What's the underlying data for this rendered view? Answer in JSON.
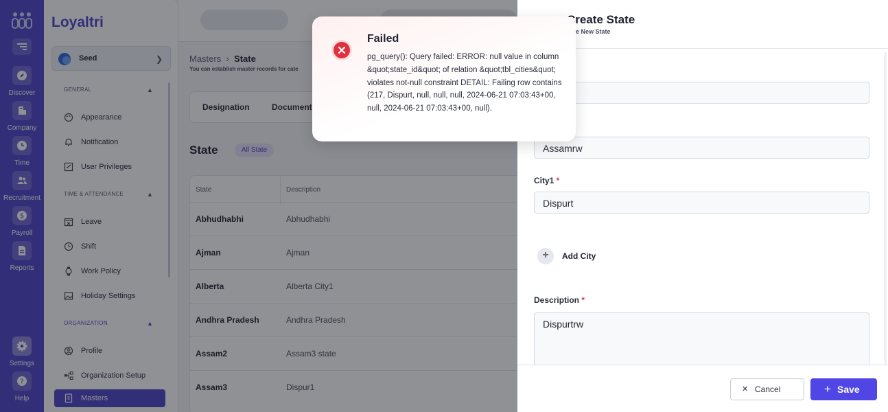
{
  "rail": {
    "items": [
      {
        "label": "Discover",
        "icon": "compass-icon"
      },
      {
        "label": "Company",
        "icon": "building-icon"
      },
      {
        "label": "Time",
        "icon": "clock-icon"
      },
      {
        "label": "Recruitment",
        "icon": "people-icon"
      },
      {
        "label": "Payroll",
        "icon": "dollar-icon"
      },
      {
        "label": "Reports",
        "icon": "report-icon"
      },
      {
        "label": "Settings",
        "icon": "gear-icon"
      },
      {
        "label": "Help",
        "icon": "help-icon"
      }
    ]
  },
  "sidebar": {
    "brand": "Loyaltri",
    "org_name": "Seed",
    "sections": [
      {
        "title": "GENERAL",
        "items": [
          "Appearance",
          "Notification",
          "User Privileges"
        ]
      },
      {
        "title": "TIME & ATTENDANCE",
        "items": [
          "Leave",
          "Shift",
          "Work Policy",
          "Holiday Settings"
        ]
      },
      {
        "title": "ORGANIZATION",
        "items": [
          "Profile",
          "Organization Setup",
          "Masters"
        ]
      }
    ],
    "active_item": "Masters"
  },
  "page": {
    "breadcrumb_parent": "Masters",
    "breadcrumb_current": "State",
    "description": "You can establish master records for cate",
    "tabs": [
      "Designation",
      "Document"
    ],
    "title": "State",
    "badge": "All State"
  },
  "table": {
    "headers": [
      "State",
      "Description"
    ],
    "rows": [
      [
        "Abhudhabhi",
        "Abhudhabhi"
      ],
      [
        "Ajman",
        "Ajman"
      ],
      [
        "Alberta",
        "Alberta City1"
      ],
      [
        "Andhra Pradesh",
        "Andhra Pradesh"
      ],
      [
        "Assam2",
        "Assam3 state"
      ],
      [
        "Assam3",
        "Dispur1"
      ]
    ]
  },
  "drawer": {
    "title": "Create State",
    "subtitle": "eate New State",
    "state_value": "Assamrw",
    "city_label": "City1",
    "city_value": "Dispurt",
    "add_city": "Add City",
    "description_label": "Description",
    "description_value": "Dispurtrw",
    "cancel": "Cancel",
    "save": "Save"
  },
  "toast": {
    "title": "Failed",
    "message": "pg_query(): Query failed: ERROR: null value in column &quot;state_id&quot; of relation &quot;tbl_cities&quot; violates not-null constraint DETAIL: Failing row contains (217, Dispurt, null, null, null, 2024-06-21 07:03:43+00, null, 2024-06-21 07:03:43+00, null)."
  },
  "colors": {
    "brand": "#4f46c8",
    "primary_button": "#4f46e5",
    "error": "#e0313f",
    "required": "#d63a4a"
  }
}
